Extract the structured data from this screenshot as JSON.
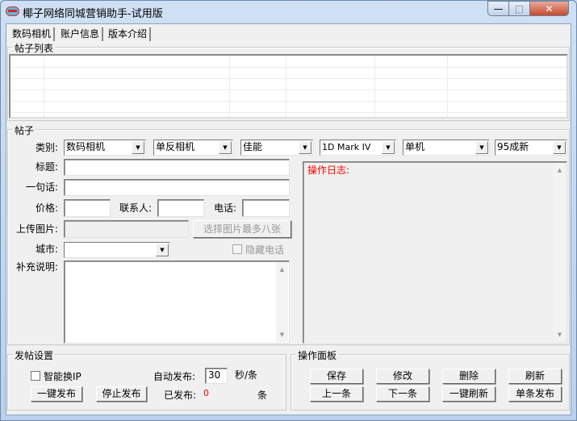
{
  "window": {
    "title": "椰子网络同城营销助手-试用版",
    "minimize": "—",
    "maximize": "□",
    "close": "✕"
  },
  "tabs": [
    {
      "label": "数码相机",
      "active": true
    },
    {
      "label": "账户信息"
    },
    {
      "label": "版本介绍"
    }
  ],
  "post_list": {
    "label": "帖子列表"
  },
  "post": {
    "label": "帖子",
    "category_label": "类别:",
    "categories": [
      "数码相机",
      "单反相机",
      "佳能",
      "1D Mark IV",
      "单机",
      "95成新"
    ],
    "title_label": "标题:",
    "title_value": "",
    "slogan_label": "一句话:",
    "slogan_value": "",
    "price_label": "价格:",
    "price_value": "",
    "contact_label": "联系人:",
    "contact_value": "",
    "phone_label": "电话:",
    "phone_value": "",
    "upload_label": "上传图片:",
    "upload_button": "选择图片最多八张",
    "city_label": "城市:",
    "city_value": "",
    "hide_phone_label": "隐藏电话",
    "hide_phone_checked": false,
    "notes_label": "补充说明:",
    "notes_value": "",
    "log_label": "操作日志:"
  },
  "settings": {
    "label": "发帖设置",
    "smart_ip_label": "智能换IP",
    "smart_ip_checked": false,
    "auto_label": "自动发布:",
    "auto_value": "30",
    "auto_unit": "秒/条",
    "one_click": "一键发布",
    "stop": "停止发布",
    "published_label": "已发布:",
    "published_count": "0",
    "published_unit": "条"
  },
  "panel": {
    "label": "操作面板",
    "buttons": [
      "保存",
      "修改",
      "删除",
      "刷新",
      "上一条",
      "下一条",
      "一键刷新",
      "单条发布"
    ]
  },
  "colors": {
    "log": "#ff0000",
    "count": "#ff0000"
  }
}
